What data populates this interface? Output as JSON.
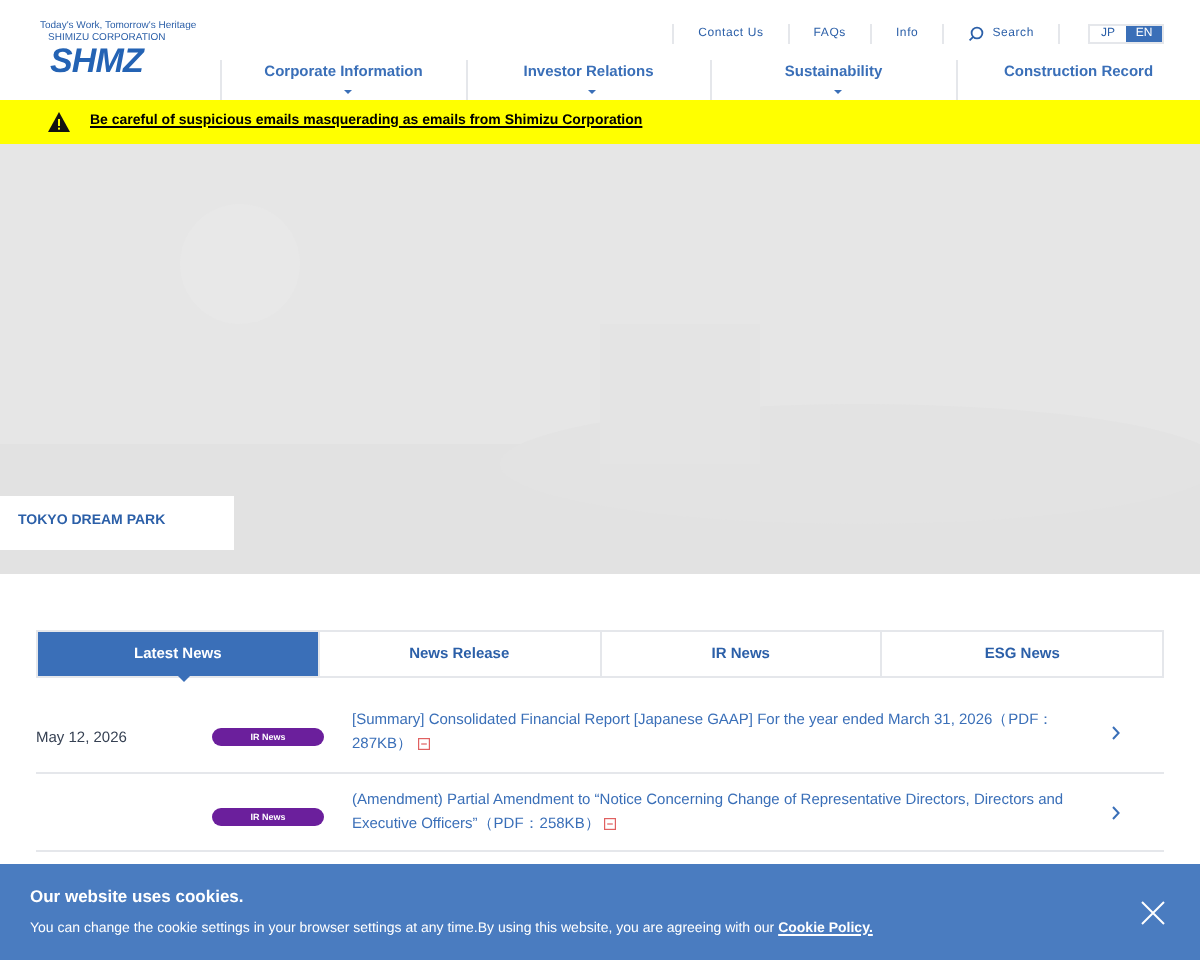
{
  "logo": {
    "tagline": "Today's Work, Tomorrow's Heritage",
    "subtitle": "SHIMIZU CORPORATION",
    "wordmark": "SHMZ"
  },
  "utility_links": [
    {
      "label": "Contact Us"
    },
    {
      "label": "FAQs"
    },
    {
      "label": "Info"
    },
    {
      "label": "Search",
      "kind": "search"
    }
  ],
  "languages": [
    {
      "label": "JP",
      "selected": false
    },
    {
      "label": "EN",
      "selected": true
    }
  ],
  "nav": [
    {
      "label": "Corporate Information",
      "has_menu": true
    },
    {
      "label": "Investor Relations",
      "has_menu": true
    },
    {
      "label": "Sustainability",
      "has_menu": true
    },
    {
      "label": "Construction Record",
      "has_menu": false
    }
  ],
  "alert": {
    "text": "Be careful of suspicious emails masquerading as emails from Shimizu Corporation"
  },
  "hero": {
    "caption": "TOKYO DREAM PARK"
  },
  "tabs": [
    {
      "label": "Latest News",
      "selected": true
    },
    {
      "label": "News Release",
      "selected": false
    },
    {
      "label": "IR News",
      "selected": false
    },
    {
      "label": "ESG News",
      "selected": false
    }
  ],
  "news": [
    {
      "date": "May 12, 2026",
      "tag": "IR News",
      "title": "[Summary] Consolidated Financial Report [Japanese GAAP] For the year ended March 31, 2026（PDF：287KB）"
    },
    {
      "tag": "IR News",
      "title": "(Amendment) Partial Amendment to “Notice Concerning Change of Representative Directors, Directors and Executive Officers”（PDF：258KB）"
    }
  ],
  "cookie_banner": {
    "title": "Our website uses cookies.",
    "text": "You can change the cookie settings in your browser settings at any time.By using this website, you are agreeing with our ",
    "link": "Cookie Policy."
  }
}
